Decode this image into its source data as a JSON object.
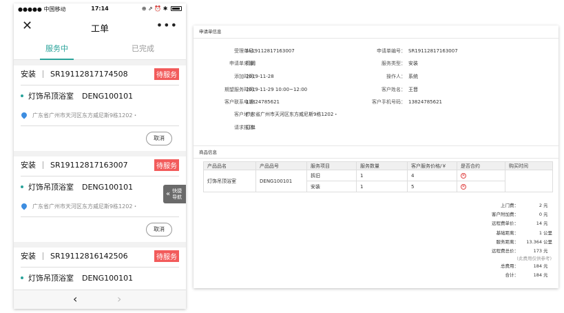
{
  "status_bar": {
    "carrier": "●●●●● 中国移动",
    "time": "17:14",
    "icons": "⊕ ⇗ ⏰ ✱"
  },
  "navbar": {
    "close": "✕",
    "title": "工单",
    "more": "•••"
  },
  "tabs": [
    {
      "label": "服务中",
      "active": true
    },
    {
      "label": "已完成",
      "active": false
    }
  ],
  "orders": [
    {
      "type": "安装",
      "number": "SR19112817174508",
      "status": "待服务",
      "product": "灯饰吊顶浴室",
      "code": "DENG100101",
      "address": "广东省广州市天河区东方威尼斯9栋1202・",
      "cancel": "取消"
    },
    {
      "type": "安装",
      "number": "SR19112817163007",
      "status": "待服务",
      "product": "灯饰吊顶浴室",
      "code": "DENG100101",
      "address": "广东省广州市天河区东方威尼斯9栋1202・",
      "cancel": "取消"
    },
    {
      "type": "安装",
      "number": "SR19112816142506",
      "status": "待服务",
      "product": "灯饰吊顶浴室",
      "code": "DENG100101"
    }
  ],
  "quick_nav": {
    "arrow": "«",
    "line1": "快捷",
    "line2": "导航"
  },
  "bottom_bar": {
    "back": "‹",
    "forward": "›"
  },
  "panel": {
    "section1_title": "申请单信息",
    "fields": {
      "accept_no": {
        "label": "受理单号：",
        "value": "SL19112817163007"
      },
      "apply_no": {
        "label": "申请单编号：",
        "value": "SR19112817163007"
      },
      "source": {
        "label": "申请单来源：",
        "value": "贝朗"
      },
      "service_type": {
        "label": "服务类型：",
        "value": "安装"
      },
      "add_time": {
        "label": "添加时间：",
        "value": "2019-11-28"
      },
      "operator": {
        "label": "操作人：",
        "value": "系统"
      },
      "expected_time": {
        "label": "期望服务时间：",
        "value": "2019-11-29 10:00~12:00"
      },
      "customer_name": {
        "label": "客户姓名：",
        "value": "王晋"
      },
      "contact_phone": {
        "label": "客户联系电话：",
        "value": "13824785621"
      },
      "mobile": {
        "label": "客户手机号码：",
        "value": "13824785621"
      },
      "address": {
        "label": "客户地址：",
        "value": "广东省广州市天河区东方威尼斯9栋1202・"
      },
      "description": {
        "label": "请求描述：",
        "value": "订单"
      }
    },
    "section2_title": "商品信息",
    "table": {
      "headers": [
        "产品品名",
        "产品品号",
        "服务项目",
        "服务数量",
        "客户服务价格/￥",
        "是否合约",
        "购买时间"
      ],
      "product_name": "灯饰吊顶浴室",
      "product_code": "DENG100101",
      "rows": [
        {
          "service": "拆旧",
          "qty": "1",
          "price": "4",
          "contract": "✕"
        },
        {
          "service": "安装",
          "qty": "1",
          "price": "5",
          "contract": "✕"
        }
      ]
    },
    "summary": [
      {
        "label": "上门费：",
        "value": "2",
        "unit": "元"
      },
      {
        "label": "客户附加费：",
        "value": "0",
        "unit": "元"
      },
      {
        "label": "远程费单价：",
        "value": "14",
        "unit": "元"
      },
      {
        "label": "基础距离：",
        "value": "1",
        "unit": "公里"
      },
      {
        "label": "服务距离：",
        "value": "13.364",
        "unit": "公里"
      },
      {
        "label": "远程费总价：",
        "value": "173",
        "unit": "元"
      }
    ],
    "summary_note": "(此费用仅供参考)",
    "summary_after": [
      {
        "label": "总费用：",
        "value": "184",
        "unit": "元"
      },
      {
        "label": "合计：",
        "value": "184",
        "unit": "元"
      }
    ]
  }
}
